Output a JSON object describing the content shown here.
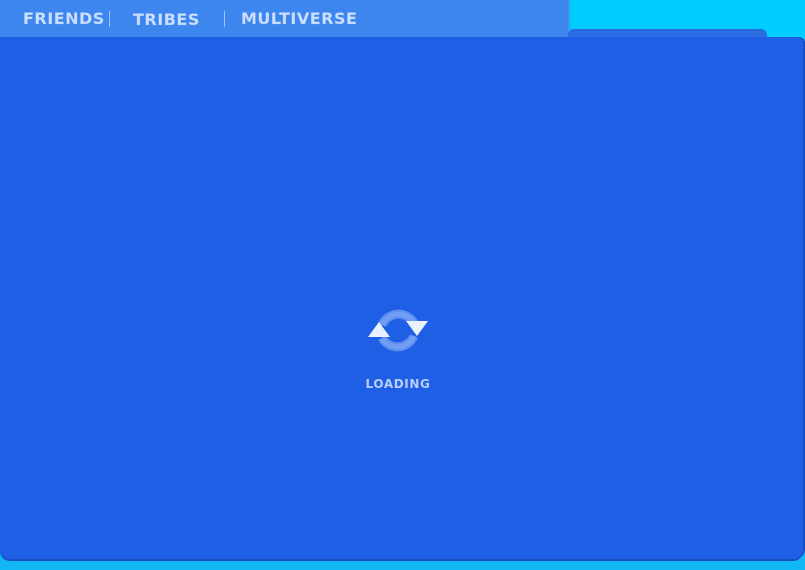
{
  "tabs": {
    "friends": "Friends",
    "tribes": "Tribes",
    "multiverse": "Multiverse"
  },
  "loader": {
    "label": "Loading",
    "icon": "refresh-icon"
  },
  "colors": {
    "tab_bar": "#3d86ee",
    "tab_text": "#cfe0ff",
    "right_header": "#00ccff",
    "panel": "#1f5fe6",
    "frame": "#12b6f2",
    "loader_text": "#b9cffa"
  }
}
